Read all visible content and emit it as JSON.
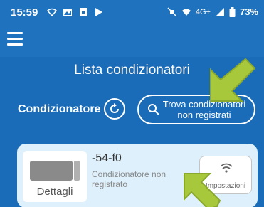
{
  "status_bar": {
    "time": "15:59",
    "network": "4G+",
    "battery": "73%"
  },
  "title_bar": {
    "title": "Lista condizionatori"
  },
  "toolbar": {
    "section_label": "Condizionatore",
    "find_button_label": "Trova condizionatori non registrati"
  },
  "device_card": {
    "thumbnail_label": "Dettagli",
    "name": "-54-f0",
    "status": "Condizionatore non registrato",
    "settings_label": "Impostazioni"
  },
  "colors": {
    "primary": "#1b6cb8",
    "card_bg": "#ddf0fb",
    "arrow": "#a8c83c"
  },
  "icons": [
    "hamburger-menu-icon",
    "refresh-icon",
    "search-icon",
    "wifi-icon",
    "air-conditioner-icon"
  ]
}
